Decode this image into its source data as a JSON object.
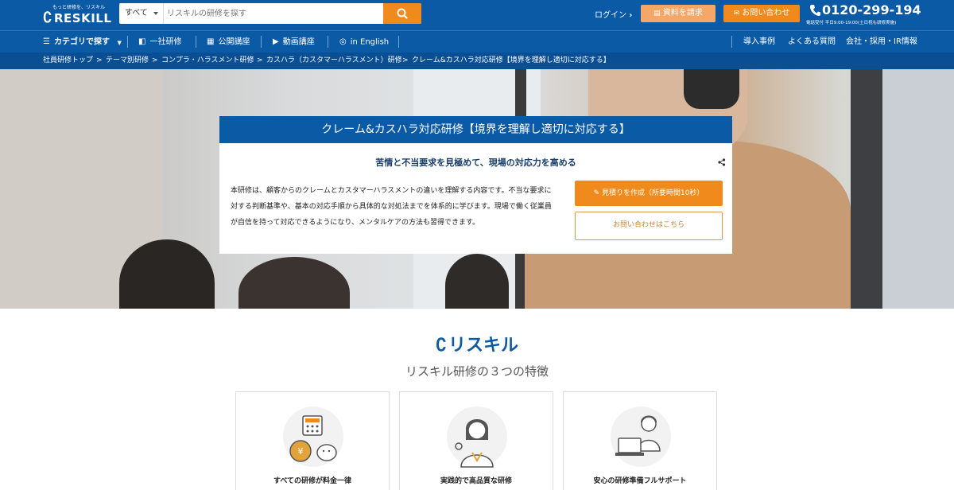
{
  "header": {
    "logo_tagline": "もっと研修を、リスキル",
    "logo_text": "RESKILL",
    "search_scope": "すべて",
    "search_placeholder": "リスキルの研修を探す",
    "login_label": "ログイン",
    "doc_request_label": "資料を請求",
    "contact_label": "お問い合わせ",
    "phone_number": "0120-299-194",
    "phone_hours": "電話受付 平日9:00-19:00(土日祝も研修実施)"
  },
  "nav": {
    "category_label": "カテゴリで探す",
    "items": [
      "一社研修",
      "公開講座",
      "動画講座",
      "in English"
    ],
    "right_items": [
      "導入事例",
      "よくある質問",
      "会社・採用・IR情報"
    ]
  },
  "breadcrumb": [
    "社員研修トップ",
    "テーマ別研修",
    "コンプラ・ハラスメント研修",
    "カスハラ（カスタマーハラスメント）研修",
    "クレーム&カスハラ対応研修【境界を理解し適切に対応する】"
  ],
  "hero": {
    "title": "クレーム&カスハラ対応研修【境界を理解し適切に対応する】",
    "subtitle": "苦情と不当要求を見極めて、現場の対応力を高める",
    "description": "本研修は、顧客からのクレームとカスタマーハラスメントの違いを理解する内容です。不当な要求に対する判断基準や、基本の対応手順から具体的な対処法までを体系的に学びます。現場で働く従業員が自信を持って対応できるようになり、メンタルケアの方法も習得できます。",
    "quote_button": "見積りを作成（所要時間10秒）",
    "contact_button": "お問い合わせはこちら"
  },
  "features": {
    "brand": "リスキル",
    "title": "リスキル研修の３つの特徴",
    "cards": [
      {
        "label": "すべての研修が料金一律",
        "icon": "calculator-coin-piggybank-icon"
      },
      {
        "label": "実践的で高品質な研修",
        "icon": "instructor-ok-icon"
      },
      {
        "label": "安心の研修準備フルサポート",
        "icon": "support-operator-icon"
      }
    ]
  },
  "colors": {
    "primary_blue": "#0b5aa6",
    "accent_orange": "#f08a1c"
  }
}
